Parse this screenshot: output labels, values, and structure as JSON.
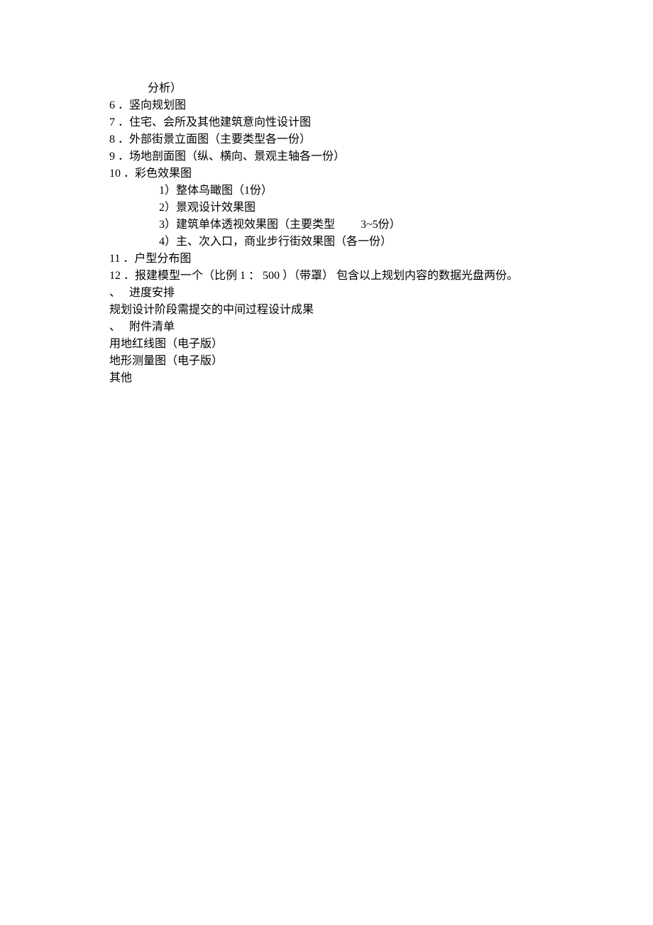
{
  "lines": {
    "l0": "分析）",
    "l1a": "6 ．",
    "l1b": "竖向规划图",
    "l2a": "7 ．",
    "l2b": "住宅、会所及其他建筑意向性设计图",
    "l3a": "8 ．",
    "l3b": "外部街景立面图（主要类型各一份）",
    "l4a": "9 ．",
    "l4b": "场地剖面图（纵、横向、景观主轴各一份）",
    "l5a": "10 ．",
    "l5b": "彩色效果图",
    "l6": "1）整体鸟瞰图（1份）",
    "l7": "2）景观设计效果图",
    "l8a": "3）建筑单体透视效果图（主要类型",
    "l8b": "3~5份）",
    "l9": "4）主、次入口，商业步行街效果图（各一份）",
    "l10a": "11 ．",
    "l10b": "户型分布图",
    "l11a": "12 ．",
    "l11b": "报建模型一个（比例 1 ： 500 ）（带罩） 包含以上规划内容的数据光盘两份。",
    "l12a": "、",
    "l12b": "进度安排",
    "l13": "规划设计阶段需提交的中间过程设计成果",
    "l14a": "、",
    "l14b": "附件清单",
    "l15": "用地红线图（电子版）",
    "l16": "地形测量图（电子版）",
    "l17": "其他"
  }
}
